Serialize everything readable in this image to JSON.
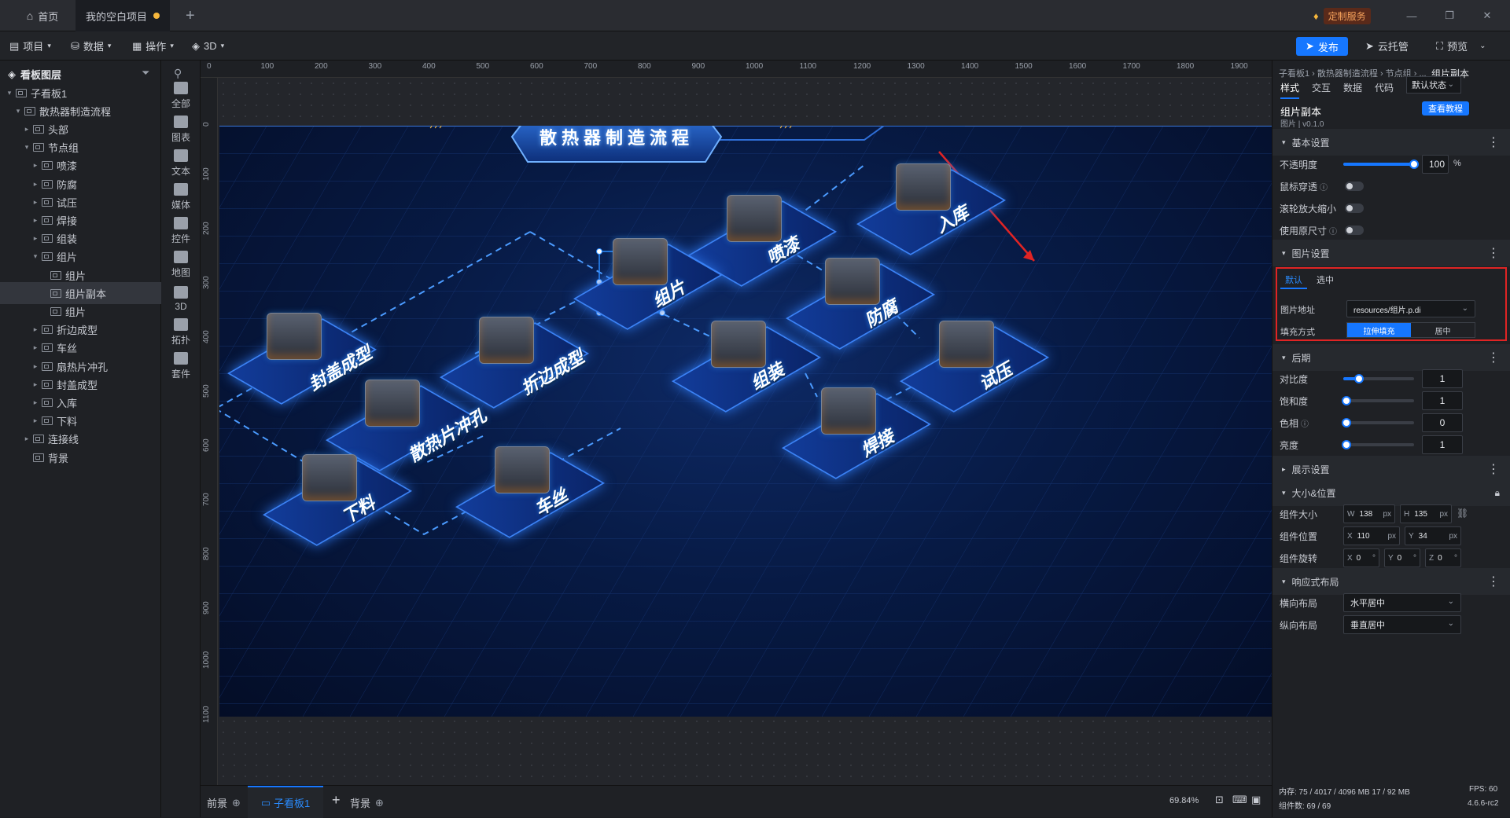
{
  "tabs": {
    "home": "首页",
    "project": "我的空白项目",
    "add": "+"
  },
  "window": {
    "service": "定制服务",
    "minimize": "—",
    "restore": "❐",
    "close": "✕"
  },
  "toolbar": {
    "project": "项目",
    "data": "数据",
    "operate": "操作",
    "three_d": "3D",
    "publish": "发布",
    "cloud": "云托管",
    "preview": "预览"
  },
  "layers": {
    "title": "看板图层",
    "items": [
      {
        "label": "子看板1",
        "depth": 0,
        "caret": "▾"
      },
      {
        "label": "散热器制造流程",
        "depth": 1,
        "caret": "▾"
      },
      {
        "label": "头部",
        "depth": 2,
        "caret": "▸"
      },
      {
        "label": "节点组",
        "depth": 2,
        "caret": "▾"
      },
      {
        "label": "喷漆",
        "depth": 3,
        "caret": "▸"
      },
      {
        "label": "防腐",
        "depth": 3,
        "caret": "▸"
      },
      {
        "label": "试压",
        "depth": 3,
        "caret": "▸"
      },
      {
        "label": "焊接",
        "depth": 3,
        "caret": "▸"
      },
      {
        "label": "组装",
        "depth": 3,
        "caret": "▸"
      },
      {
        "label": "组片",
        "depth": 3,
        "caret": "▾"
      },
      {
        "label": "组片",
        "depth": 4,
        "caret": ""
      },
      {
        "label": "组片副本",
        "depth": 4,
        "caret": "",
        "selected": true
      },
      {
        "label": "组片",
        "depth": 4,
        "caret": ""
      },
      {
        "label": "折边成型",
        "depth": 3,
        "caret": "▸"
      },
      {
        "label": "车丝",
        "depth": 3,
        "caret": "▸"
      },
      {
        "label": "扇热片冲孔",
        "depth": 3,
        "caret": "▸"
      },
      {
        "label": "封盖成型",
        "depth": 3,
        "caret": "▸"
      },
      {
        "label": "入库",
        "depth": 3,
        "caret": "▸"
      },
      {
        "label": "下料",
        "depth": 3,
        "caret": "▸"
      },
      {
        "label": "连接线",
        "depth": 2,
        "caret": "▸"
      },
      {
        "label": "背景",
        "depth": 2,
        "caret": ""
      }
    ]
  },
  "rail": [
    "全部",
    "图表",
    "文本",
    "媒体",
    "控件",
    "地图",
    "3D",
    "拓扑",
    "套件"
  ],
  "ruler": {
    "h": [
      "0",
      "100",
      "200",
      "300",
      "400",
      "500",
      "600",
      "700",
      "800",
      "900",
      "1000",
      "1100",
      "1200",
      "1300",
      "1400",
      "1500",
      "1600",
      "1700",
      "1800",
      "1900"
    ],
    "v": [
      "0",
      "100",
      "200",
      "300",
      "400",
      "500",
      "600",
      "700",
      "800",
      "900",
      "1000",
      "1100"
    ]
  },
  "stage": {
    "title": "散热器制造流程",
    "nodes": [
      "喷漆",
      "入库",
      "组片",
      "防腐",
      "封盖成型",
      "折边成型",
      "组装",
      "试压",
      "散热片冲孔",
      "焊接",
      "下料",
      "车丝"
    ]
  },
  "bottom": {
    "front": "前景",
    "board": "子看板1",
    "back": "背景",
    "zoom": "69.84%"
  },
  "status": {
    "memory": "内存: 75 / 4017 / 4096 MB  17 / 92 MB",
    "fps": "FPS: 60",
    "count": "组件数: 69 / 69",
    "version": "4.6.6-rc2"
  },
  "panel": {
    "breadcrumb": "子看板1 › 散热器制造流程 › 节点组 › ...",
    "current": "组片副本",
    "tabs": [
      "样式",
      "交互",
      "数据",
      "代码"
    ],
    "state": "默认状态",
    "name": "组片副本",
    "sub": "图片 | v0.1.0",
    "tutorial": "查看教程",
    "basic": "基本设置",
    "opacity_label": "不透明度",
    "opacity": "100",
    "opacity_unit": "%",
    "mouse_through": "鼠标穿透",
    "wheel_zoom": "滚轮放大缩小",
    "orig_size": "使用原尺寸",
    "img_settings": "图片设置",
    "img_tabs": [
      "默认",
      "选中"
    ],
    "img_url_label": "图片地址",
    "img_url": "resources/组片.p.di",
    "fill_label": "填充方式",
    "fill_opts": [
      "拉伸填充",
      "居中"
    ],
    "post": "后期",
    "contrast": "对比度",
    "contrast_val": "1",
    "saturation": "饱和度",
    "saturation_val": "1",
    "hue": "色相",
    "hue_val": "0",
    "brightness": "亮度",
    "brightness_val": "1",
    "display": "展示设置",
    "size_pos": "大小&位置",
    "size_label": "组件大小",
    "w": "138",
    "h": "135",
    "pos_label": "组件位置",
    "x": "110",
    "y": "34",
    "rot_label": "组件旋转",
    "rx": "0",
    "ry": "0",
    "rz": "0",
    "px": "px",
    "deg": "°",
    "responsive": "响应式布局",
    "hlayout_label": "横向布局",
    "hlayout": "水平居中",
    "vlayout_label": "纵向布局",
    "vlayout": "垂直居中"
  },
  "colors": {
    "accent": "#1677ff",
    "highlight": "#e02424",
    "dot": "#f6b73c"
  }
}
